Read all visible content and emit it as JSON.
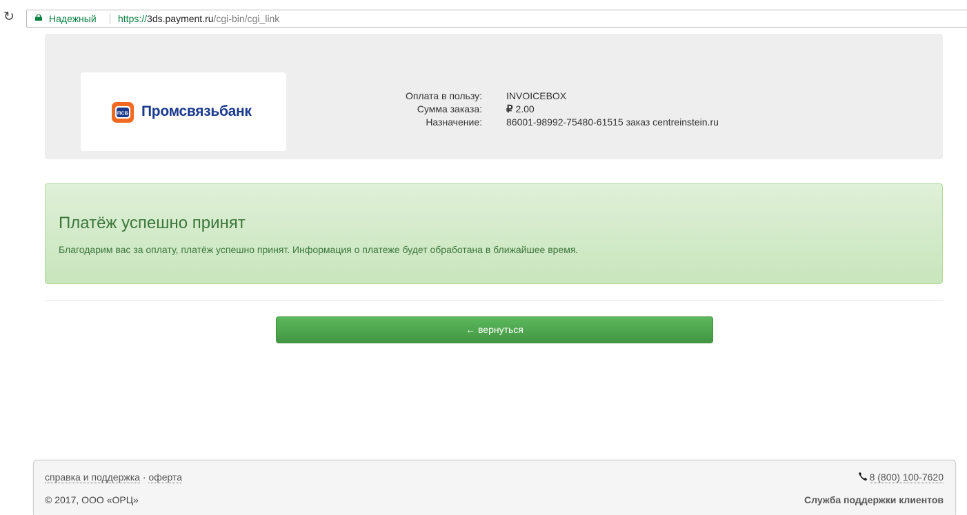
{
  "browser": {
    "secure_label": "Надежный",
    "url_scheme": "https://",
    "url_host": "3ds.payment.ru",
    "url_path": "/cgi-bin/cgi_link"
  },
  "merchant": {
    "bank_name": "Промсвязьбанк",
    "bank_badge": "ПСБ",
    "labels": {
      "recipient": "Оплата в пользу:",
      "amount": "Сумма заказа:",
      "purpose": "Назначение:"
    },
    "values": {
      "recipient": "INVOICEBOX",
      "currency_symbol": "₽",
      "amount": "2.00",
      "purpose": "86001-98992-75480-61515 заказ centreinstein.ru"
    }
  },
  "alert": {
    "title": "Платёж успешно принят",
    "message": "Благодарим вас за оплату, платёж успешно принят. Информация о платеже будет обработана в ближайшее время."
  },
  "back_button": {
    "label": "← вернуться"
  },
  "footer": {
    "help_link": "справка и поддержка",
    "separator": "·",
    "offer_link": "оферта",
    "copyright": "© 2017, ООО «ОРЦ»",
    "phone": "8 (800) 100-7620",
    "support": "Служба поддержки клиентов"
  },
  "colors": {
    "secure_green": "#0b8043",
    "alert_bg": "#dff0d8",
    "alert_text": "#3c763d",
    "button_green": "#4cae4c",
    "bank_blue": "#1b3a8c",
    "bank_orange": "#f26a21"
  }
}
